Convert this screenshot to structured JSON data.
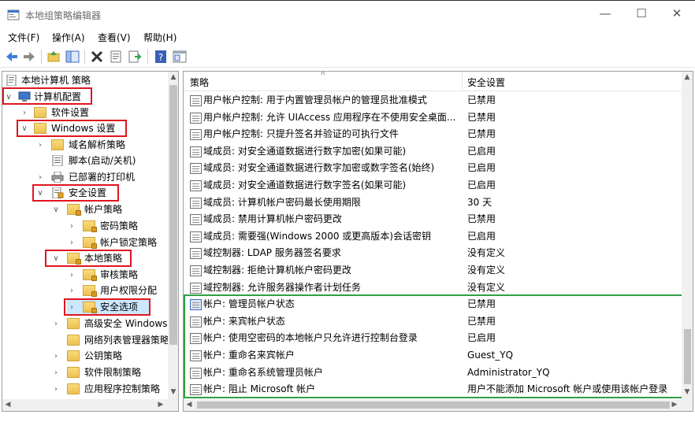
{
  "window": {
    "title": "本地组策略编辑器"
  },
  "menubar": [
    {
      "label": "文件(F)"
    },
    {
      "label": "操作(A)"
    },
    {
      "label": "查看(V)"
    },
    {
      "label": "帮助(H)"
    }
  ],
  "toolbar": {
    "buttons": [
      "back-arrow-icon",
      "forward-arrow-icon",
      "up-folder-icon",
      "show-hide-tree-icon",
      "delete-icon",
      "properties-icon",
      "export-list-icon",
      "help-icon",
      "console-icon"
    ]
  },
  "tree": {
    "root": "本地计算机 策略",
    "items": [
      {
        "label": "计算机配置"
      },
      {
        "label": "软件设置"
      },
      {
        "label": "Windows 设置"
      },
      {
        "label": "域名解析策略"
      },
      {
        "label": "脚本(启动/关机)"
      },
      {
        "label": "已部署的打印机"
      },
      {
        "label": "安全设置"
      },
      {
        "label": "帐户策略"
      },
      {
        "label": "密码策略"
      },
      {
        "label": "帐户锁定策略"
      },
      {
        "label": "本地策略"
      },
      {
        "label": "审核策略"
      },
      {
        "label": "用户权限分配"
      },
      {
        "label": "安全选项"
      },
      {
        "label": "高级安全 Windows"
      },
      {
        "label": "网络列表管理器策略"
      },
      {
        "label": "公钥策略"
      },
      {
        "label": "软件限制策略"
      },
      {
        "label": "应用程序控制策略"
      }
    ]
  },
  "list": {
    "columns": {
      "policy": "策略",
      "setting": "安全设置"
    },
    "rows": [
      {
        "name": "用户帐户控制: 用于内置管理员帐户的管理员批准模式",
        "value": "已禁用"
      },
      {
        "name": "用户帐户控制: 允许 UIAccess 应用程序在不使用安全桌面...",
        "value": "已禁用"
      },
      {
        "name": "用户帐户控制: 只提升签名并验证的可执行文件",
        "value": "已禁用"
      },
      {
        "name": "域成员: 对安全通道数据进行数字加密(如果可能)",
        "value": "已启用"
      },
      {
        "name": "域成员: 对安全通道数据进行数字加密或数字签名(始终)",
        "value": "已启用"
      },
      {
        "name": "域成员: 对安全通道数据进行数字签名(如果可能)",
        "value": "已启用"
      },
      {
        "name": "域成员: 计算机帐户密码最长使用期限",
        "value": "30 天"
      },
      {
        "name": "域成员: 禁用计算机帐户密码更改",
        "value": "已禁用"
      },
      {
        "name": "域成员: 需要强(Windows 2000 或更高版本)会话密钥",
        "value": "已启用"
      },
      {
        "name": "域控制器: LDAP 服务器签名要求",
        "value": "没有定义"
      },
      {
        "name": "域控制器: 拒绝计算机帐户密码更改",
        "value": "没有定义"
      },
      {
        "name": "域控制器: 允许服务器操作者计划任务",
        "value": "没有定义"
      },
      {
        "name": "帐户: 管理员帐户状态",
        "value": "已禁用"
      },
      {
        "name": "帐户: 来宾帐户状态",
        "value": "已禁用"
      },
      {
        "name": "帐户: 使用空密码的本地帐户只允许进行控制台登录",
        "value": "已启用"
      },
      {
        "name": "帐户: 重命名来宾帐户",
        "value": "Guest_YQ"
      },
      {
        "name": "帐户: 重命名系统管理员帐户",
        "value": "Administrator_YQ"
      },
      {
        "name": "帐户: 阻止 Microsoft 帐户",
        "value": "用户不能添加 Microsoft 帐户或使用该帐户登录"
      }
    ]
  },
  "colors": {
    "highlight_red": "#e0151f",
    "highlight_green": "#2ea043"
  }
}
